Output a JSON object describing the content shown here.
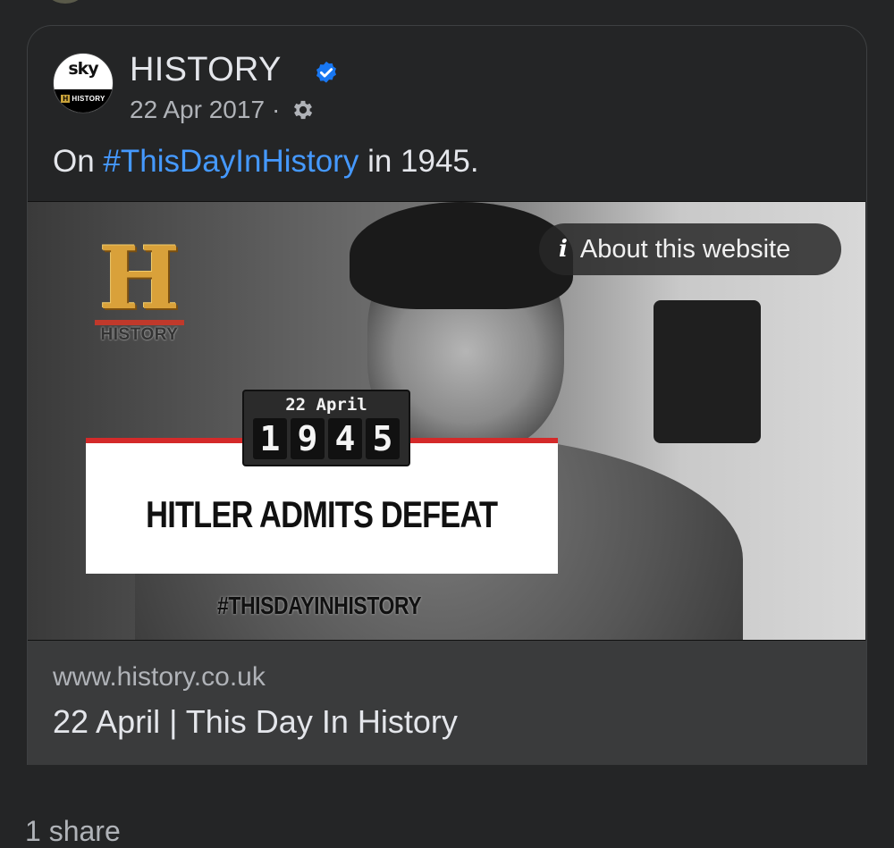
{
  "post": {
    "page_name": "HISTORY",
    "avatar_text_top": "sky",
    "avatar_text_bottom": "HISTORY",
    "avatar_badge_letter": "H",
    "date": "22 Apr 2017",
    "separator": "·",
    "text_prefix": "On ",
    "text_hashtag": "#ThisDayInHistory",
    "text_suffix": " in 1945.",
    "verified_icon": "verified-badge-icon",
    "privacy_icon": "gear-icon"
  },
  "media": {
    "about_label": "About this website",
    "about_icon": "info-icon",
    "logo_letter": "H",
    "logo_word": "HISTORY",
    "counter_day": "22 April",
    "counter_digits": [
      "1",
      "9",
      "4",
      "5"
    ],
    "headline": "HITLER ADMITS DEFEAT",
    "hashtag_caption": "#THISDAYINHISTORY"
  },
  "link": {
    "domain": "www.history.co.uk",
    "title": "22 April | This Day In History"
  },
  "footer": {
    "shares": "1 share"
  },
  "colors": {
    "background": "#242526",
    "hashtag": "#4599ff",
    "verified": "#1877f2",
    "link_footer": "#3a3b3c",
    "headline_bar": "#d42a2a"
  }
}
